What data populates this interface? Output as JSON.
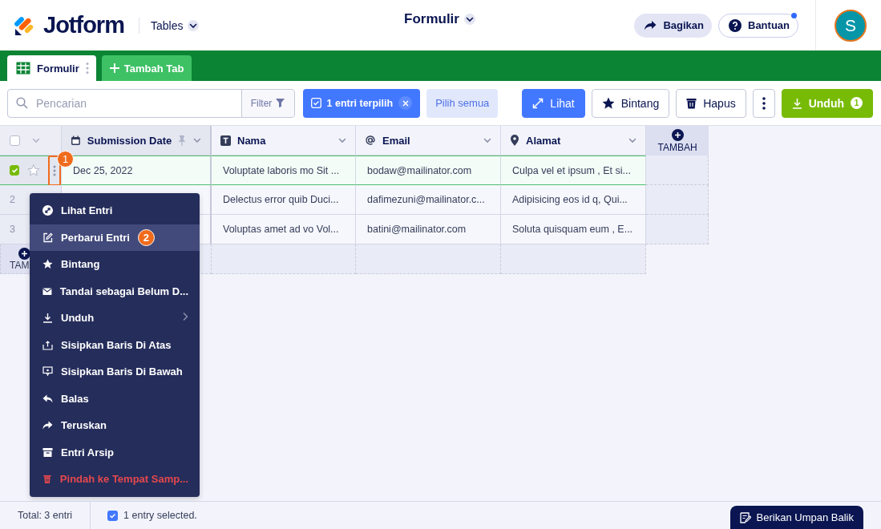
{
  "header": {
    "logo": "Jotform",
    "product": "Tables",
    "title": "Formulir",
    "share": "Bagikan",
    "help": {
      "label": "Bantuan",
      "notification": true
    },
    "avatar": "S"
  },
  "tabs": [
    {
      "label": "Formulir",
      "selected": true
    }
  ],
  "add_tab": "Tambah Tab",
  "toolbar": {
    "search": {
      "placeholder": "Pencarian"
    },
    "filter": "Filter",
    "selection": "1 entri terpilih",
    "select_all": "Pilih semua",
    "actions": [
      {
        "kind": "view",
        "label": "Lihat"
      },
      {
        "kind": "star",
        "label": "Bintang"
      },
      {
        "kind": "delete",
        "label": "Hapus"
      },
      {
        "kind": "more"
      },
      {
        "kind": "download",
        "label": "Unduh",
        "badge": "1"
      }
    ]
  },
  "table": {
    "columns": [
      {
        "kind": "date",
        "label": "Submission Date",
        "pinned": true
      },
      {
        "kind": "text",
        "label": "Nama",
        "pinned": false
      },
      {
        "kind": "email",
        "label": "Email",
        "pinned": false
      },
      {
        "kind": "address",
        "label": "Alamat",
        "pinned": false
      }
    ],
    "add_column": "TAMBAH",
    "all_checked": false,
    "rows": [
      {
        "checked": true,
        "callout": "1",
        "cells": [
          "Dec 25, 2022",
          "Voluptate laboris mo Sit ...",
          "bodaw@mailinator.com",
          "Culpa vel et ipsum , Et si..."
        ]
      },
      {
        "checked": false,
        "number": "2",
        "cells": [
          null,
          "Delectus error quib Duci...",
          "dafimezuni@mailinator.c...",
          "Adipisicing eos id q, Qui..."
        ]
      },
      {
        "checked": false,
        "number": "3",
        "cells": [
          null,
          "Voluptas amet ad vo Vol...",
          "batini@mailinator.com",
          "Soluta quisquam eum , E..."
        ]
      }
    ],
    "add_row": "TAM"
  },
  "context_menu": {
    "items": [
      {
        "kind": "view",
        "label": "Lihat Entri",
        "selected": false
      },
      {
        "kind": "edit",
        "label": "Perbarui Entri",
        "selected": true,
        "callout": "2"
      },
      {
        "kind": "star",
        "label": "Bintang",
        "selected": false
      },
      {
        "kind": "mail",
        "label": "Tandai sebagai Belum D...",
        "selected": false
      },
      {
        "kind": "download",
        "label": "Unduh",
        "selected": false,
        "submenu": true
      },
      {
        "kind": "insert-above",
        "label": "Sisipkan Baris Di Atas",
        "selected": false
      },
      {
        "kind": "insert-below",
        "label": "Sisipkan Baris Di Bawah",
        "selected": false
      },
      {
        "kind": "reply",
        "label": "Balas",
        "selected": false
      },
      {
        "kind": "forward",
        "label": "Teruskan",
        "selected": false
      },
      {
        "kind": "archive",
        "label": "Entri Arsip",
        "selected": false
      },
      {
        "kind": "trash",
        "label": "Pindah ke Tempat Samp...",
        "selected": false,
        "danger": true
      }
    ]
  },
  "footer": {
    "total": "Total: 3 entri",
    "selection": {
      "label": "1 entry selected.",
      "checked": true
    },
    "feedback": "Berikan Umpan Balik"
  }
}
